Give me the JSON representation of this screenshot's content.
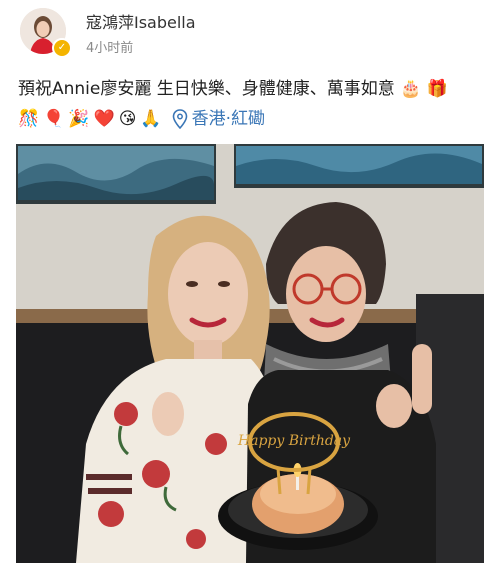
{
  "post": {
    "author": {
      "name": "寇鴻萍Isabella",
      "verified_badge_icon": "verified-check-icon"
    },
    "timestamp": "4小时前",
    "text_line1": "預祝Annie廖安麗 生日快樂、身體健康、萬事如意",
    "line1_emojis": [
      "🎂",
      "🎁"
    ],
    "line2_emojis": [
      "🎊",
      "🎈",
      "🎉",
      "❤️",
      "😘",
      "🙏"
    ],
    "location": "香港·紅磡",
    "photo": {
      "cake_topper_text": "Happy Birthday"
    }
  },
  "icons": {
    "location": "location-pin-icon"
  },
  "colors": {
    "location_link": "#3a76b6",
    "verified_badge": "#f4b400"
  }
}
